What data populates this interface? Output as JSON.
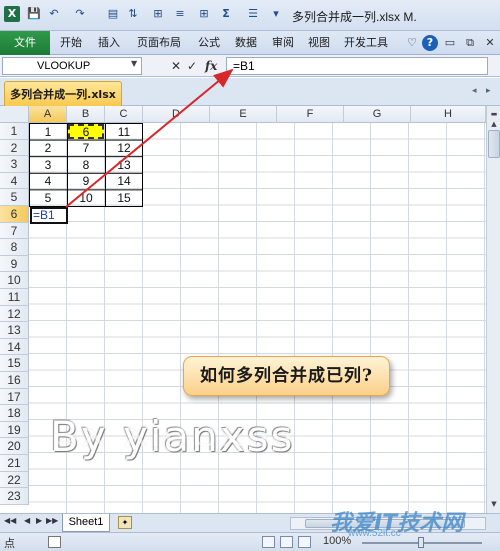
{
  "titlebar": {
    "title": "多列合并成一列.xlsx M.",
    "qat": {
      "save": "💾",
      "undo": "↶",
      "redo": "↷",
      "sum": "Σ"
    }
  },
  "ribbon": {
    "file_tab": "文件",
    "tabs": [
      "开始",
      "插入",
      "页面布局",
      "公式",
      "数据",
      "审阅",
      "视图",
      "开发工具"
    ]
  },
  "formula_bar": {
    "name_box": "VLOOKUP",
    "cancel": "✕",
    "enter": "✓",
    "fx": "fx",
    "formula": "=B1"
  },
  "workbook_tab": {
    "label": "多列合并成一列.xlsx"
  },
  "grid": {
    "columns": [
      "A",
      "B",
      "C",
      "D",
      "E",
      "F",
      "G",
      "H"
    ],
    "rows": [
      "1",
      "2",
      "3",
      "4",
      "5",
      "6",
      "7",
      "8",
      "9",
      "10",
      "11",
      "12",
      "13",
      "14",
      "15",
      "16",
      "17",
      "18",
      "19",
      "20",
      "21",
      "22",
      "23"
    ],
    "data": [
      [
        "1",
        "6",
        "11"
      ],
      [
        "2",
        "7",
        "12"
      ],
      [
        "3",
        "8",
        "13"
      ],
      [
        "4",
        "9",
        "14"
      ],
      [
        "5",
        "10",
        "15"
      ]
    ],
    "editing_cell_text": "=B1",
    "selected_column": "A",
    "selected_row": "6",
    "highlight_color": "#ffff00"
  },
  "sheets": {
    "tabs": [
      "Sheet1"
    ]
  },
  "status": {
    "ready": "点",
    "zoom": "100%"
  },
  "annotation": {
    "callout": "如何多列合并成已列?",
    "watermark": "By  yianxss",
    "site": "我爱IT技术网",
    "site_url": "www.52it.cc",
    "arrow_color": "#d9262b"
  }
}
